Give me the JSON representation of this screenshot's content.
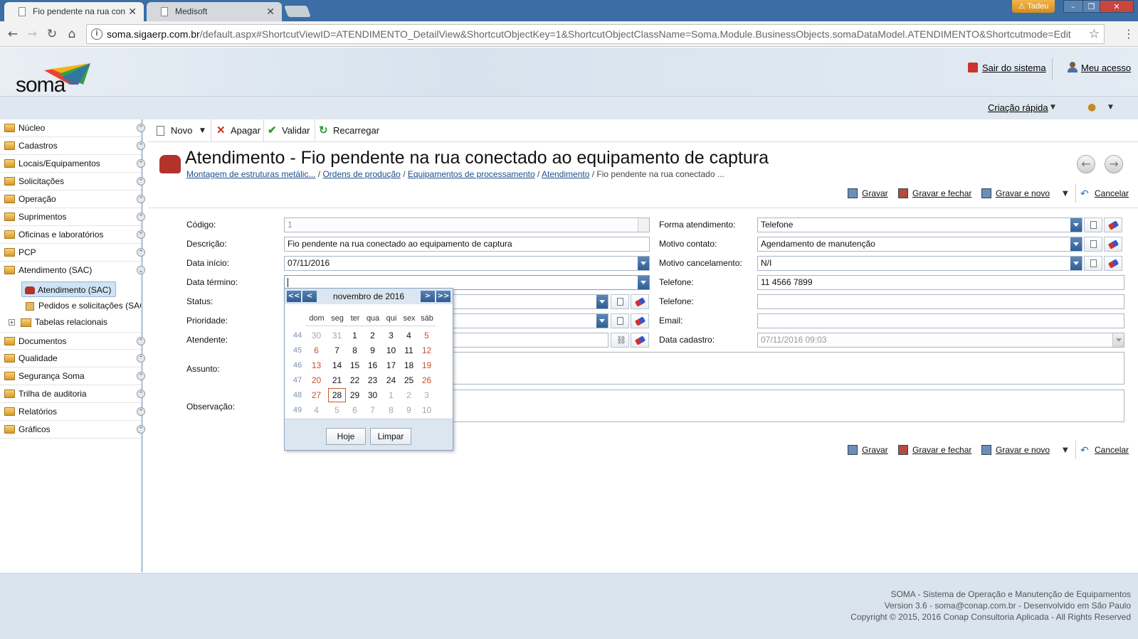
{
  "browser": {
    "tabs": [
      {
        "label": "Fio pendente na rua con",
        "active": true
      },
      {
        "label": "Medisoft",
        "active": false
      }
    ],
    "user": "Tadeu",
    "url_host": "soma.sigaerp.com.br",
    "url_path": "/default.aspx#ShortcutViewID=ATENDIMENTO_DetailView&ShortcutObjectKey=1&ShortcutObjectClassName=Soma.Module.BusinessObjects.somaDataModel.ATENDIMENTO&Shortcutmode=Edit"
  },
  "header": {
    "logo_text": "soma",
    "logout": "Sair do sistema",
    "my_access": "Meu acesso",
    "quick_create": "Criação rápida"
  },
  "sidebar": {
    "items": [
      "Núcleo",
      "Cadastros",
      "Locais/Equipamentos",
      "Solicitações",
      "Operação",
      "Suprimentos",
      "Oficinas e laboratórios",
      "PCP",
      "Atendimento (SAC)",
      "Documentos",
      "Qualidade",
      "Segurança Soma",
      "Trilha de auditoria",
      "Relatórios",
      "Gráficos"
    ],
    "sub_items": [
      "Atendimento (SAC)",
      "Pedidos e solicitações (SAC",
      "Tabelas relacionais"
    ]
  },
  "toolbar": {
    "new": "Novo",
    "delete": "Apagar",
    "validate": "Validar",
    "reload": "Recarregar"
  },
  "page": {
    "title": "Atendimento - Fio pendente na rua conectado ao equipamento de captura",
    "breadcrumb": [
      "Montagem de estruturas metálic...",
      "Ordens de produção",
      "Equipamentos de processamento",
      "Atendimento"
    ],
    "breadcrumb_current": "Fio pendente na rua conectado ..."
  },
  "actions": {
    "save": "Gravar",
    "save_close": "Gravar e fechar",
    "save_new": "Gravar e novo",
    "cancel": "Cancelar"
  },
  "form": {
    "codigo_label": "Código:",
    "codigo_value": "1",
    "descricao_label": "Descrição:",
    "descricao_value": "Fio pendente na rua conectado ao equipamento de captura",
    "data_inicio_label": "Data início:",
    "data_inicio_value": "07/11/2016",
    "data_termino_label": "Data término:",
    "data_termino_value": "",
    "status_label": "Status:",
    "prioridade_label": "Prioridade:",
    "atendente_label": "Atendente:",
    "assunto_label": "Assunto:",
    "observacao_label": "Observação:",
    "forma_label": "Forma atendimento:",
    "forma_value": "Telefone",
    "motivo_contato_label": "Motivo contato:",
    "motivo_contato_value": "Agendamento de manutenção",
    "motivo_cancel_label": "Motivo cancelamento:",
    "motivo_cancel_value": "N/I",
    "telefone1_label": "Telefone:",
    "telefone1_value": "11 4566 7899",
    "telefone2_label": "Telefone:",
    "telefone2_value": "",
    "email_label": "Email:",
    "email_value": "",
    "data_cadastro_label": "Data cadastro:",
    "data_cadastro_value": "07/11/2016 09:03"
  },
  "calendar": {
    "month_title": "novembro de 2016",
    "prev_year": "<<",
    "prev_month": "<",
    "next_month": ">",
    "next_year": ">>",
    "weekdays": [
      "dom",
      "seg",
      "ter",
      "qua",
      "qui",
      "sex",
      "sáb"
    ],
    "weeks": [
      {
        "num": "44",
        "days": [
          "30",
          "31",
          "1",
          "2",
          "3",
          "4",
          "5"
        ]
      },
      {
        "num": "45",
        "days": [
          "6",
          "7",
          "8",
          "9",
          "10",
          "11",
          "12"
        ]
      },
      {
        "num": "46",
        "days": [
          "13",
          "14",
          "15",
          "16",
          "17",
          "18",
          "19"
        ]
      },
      {
        "num": "47",
        "days": [
          "20",
          "21",
          "22",
          "23",
          "24",
          "25",
          "26"
        ]
      },
      {
        "num": "48",
        "days": [
          "27",
          "28",
          "29",
          "30",
          "1",
          "2",
          "3"
        ]
      },
      {
        "num": "49",
        "days": [
          "4",
          "5",
          "6",
          "7",
          "8",
          "9",
          "10"
        ]
      }
    ],
    "today_label": "Hoje",
    "clear_label": "Limpar"
  },
  "footer": {
    "line1": "SOMA - Sistema de Operação e Manutenção de Equipamentos",
    "line2": "Version 3.6 - soma@conap.com.br - Desenvolvido em São Paulo",
    "line3": "Copyright © 2015, 2016 Conap Consultoria Aplicada - All Rights Reserved"
  },
  "colors": {
    "accent": "#2d5f98",
    "weekend": "#c9502c",
    "link": "#1b4f8c"
  }
}
